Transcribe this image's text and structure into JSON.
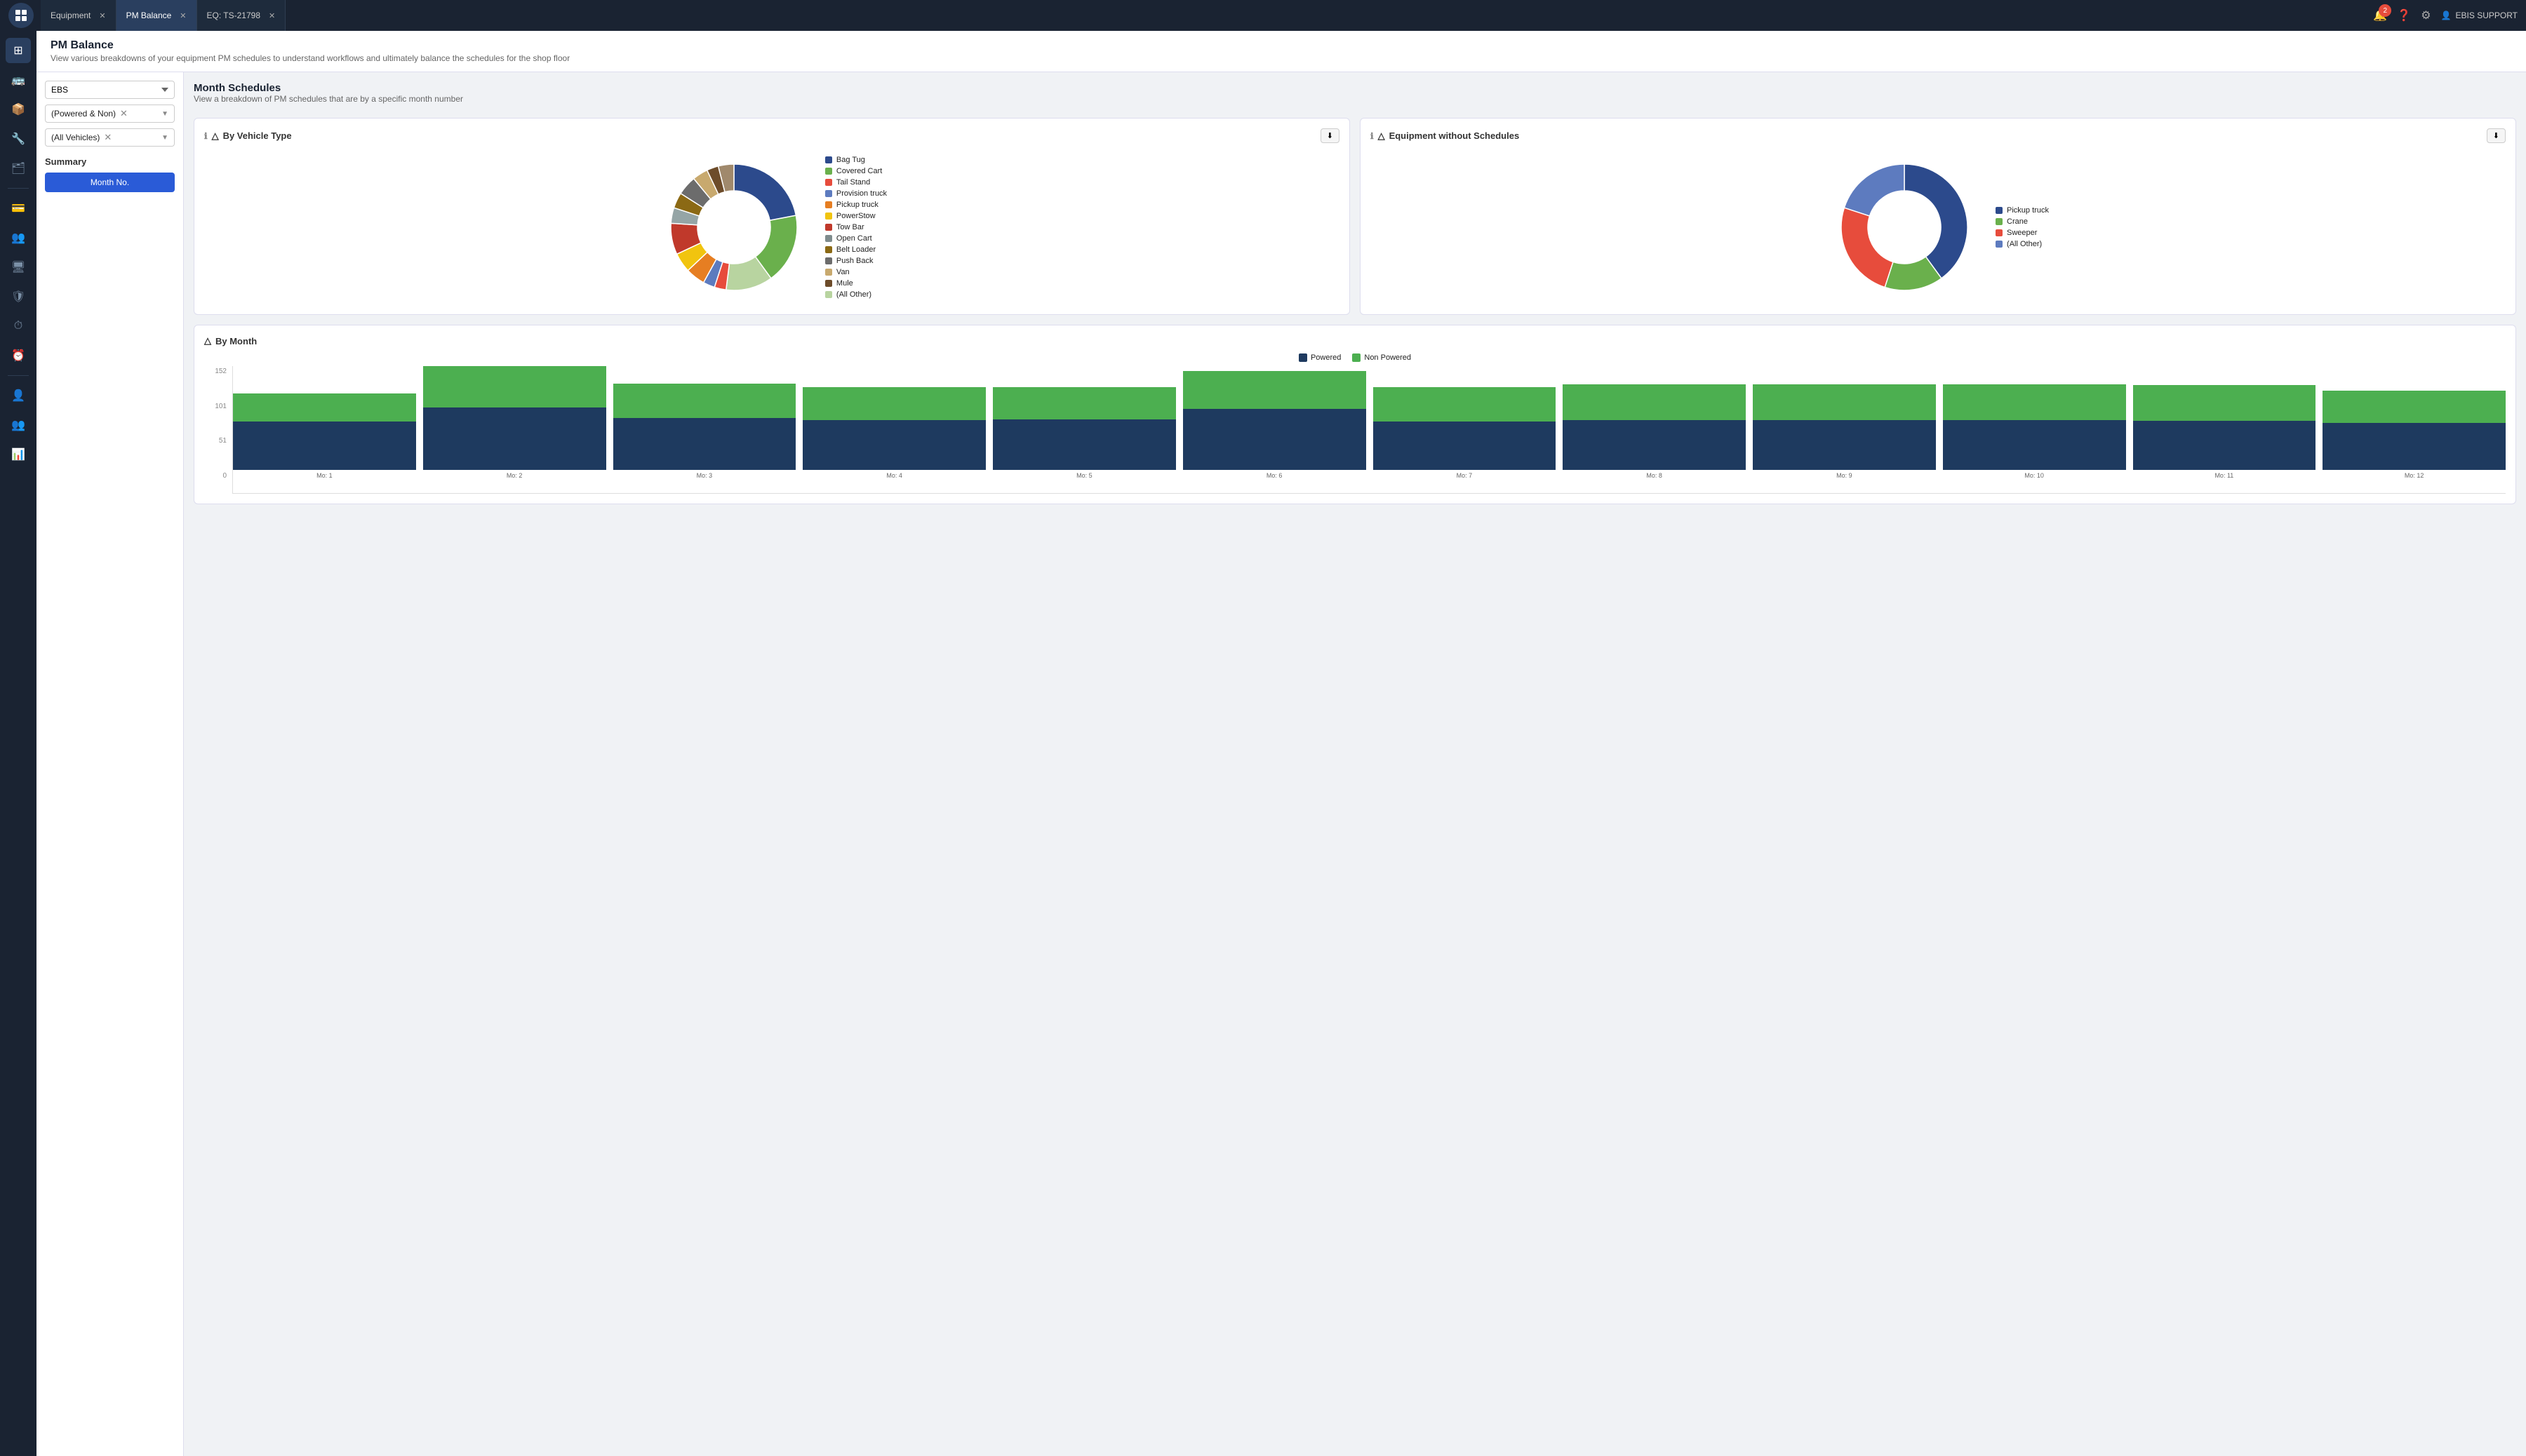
{
  "topbar": {
    "logo_text": "☰",
    "tabs": [
      {
        "label": "Equipment",
        "active": false,
        "closable": true
      },
      {
        "label": "PM Balance",
        "active": true,
        "closable": true
      },
      {
        "label": "EQ: TS-21798",
        "active": false,
        "closable": true
      }
    ],
    "notification_count": "2",
    "user_label": "EBIS SUPPORT"
  },
  "sidebar": {
    "icons": [
      "⊞",
      "🚌",
      "📦",
      "🔧",
      "🗂",
      "💳",
      "👥",
      "🖥",
      "🛡",
      "⏱",
      "⏰",
      "👤",
      "👥",
      "📊"
    ]
  },
  "left_panel": {
    "filter1": "EBS",
    "filter2_label": "(Powered & Non)",
    "filter3_label": "(All Vehicles)",
    "summary_label": "Summary",
    "month_no_label": "Month No."
  },
  "page_header": {
    "title": "PM Balance",
    "subtitle": "View various breakdowns of your equipment PM schedules to understand workflows and ultimately balance the schedules for the shop floor"
  },
  "month_schedules": {
    "title": "Month Schedules",
    "subtitle": "View a breakdown of PM schedules that are by a specific month number",
    "by_vehicle_type_title": "By Vehicle Type",
    "equipment_without_schedules_title": "Equipment without Schedules",
    "by_month_title": "By Month",
    "export_label": "⬇"
  },
  "donut1_legend": [
    {
      "label": "Bag Tug",
      "color": "#2c4a8c"
    },
    {
      "label": "Covered Cart",
      "color": "#6ab04c"
    },
    {
      "label": "Tail Stand",
      "color": "#e74c3c"
    },
    {
      "label": "Provision truck",
      "color": "#5d7bbf"
    },
    {
      "label": "Pickup truck",
      "color": "#e67e22"
    },
    {
      "label": "PowerStow",
      "color": "#f1c40f"
    },
    {
      "label": "Tow Bar",
      "color": "#c0392b"
    },
    {
      "label": "Open Cart",
      "color": "#7f8c8d"
    },
    {
      "label": "Belt Loader",
      "color": "#8B6914"
    },
    {
      "label": "Push Back",
      "color": "#6c6c6c"
    },
    {
      "label": "Van",
      "color": "#c8a96e"
    },
    {
      "label": "Mule",
      "color": "#6d4c2a"
    },
    {
      "label": "(All Other)",
      "color": "#b8d4a0"
    }
  ],
  "donut1_segments": [
    {
      "label": "Bag Tug",
      "color": "#2c4a8c",
      "pct": 22
    },
    {
      "label": "Covered Cart",
      "color": "#6ab04c",
      "pct": 18
    },
    {
      "label": "All Other light",
      "color": "#b8d4a0",
      "pct": 12
    },
    {
      "label": "Tail Stand",
      "color": "#e74c3c",
      "pct": 3
    },
    {
      "label": "Provision truck",
      "color": "#5d7bbf",
      "pct": 3
    },
    {
      "label": "Pickup truck",
      "color": "#e67e22",
      "pct": 5
    },
    {
      "label": "PowerStow",
      "color": "#f1c40f",
      "pct": 5
    },
    {
      "label": "Tow Bar",
      "color": "#c0392b",
      "pct": 8
    },
    {
      "label": "Open Cart",
      "color": "#95a5a6",
      "pct": 4
    },
    {
      "label": "Belt Loader",
      "color": "#8B6914",
      "pct": 4
    },
    {
      "label": "Push Back",
      "color": "#6c6c6c",
      "pct": 5
    },
    {
      "label": "Van",
      "color": "#c8a96e",
      "pct": 4
    },
    {
      "label": "Mule",
      "color": "#6d4c2a",
      "pct": 3
    },
    {
      "label": "tan segment",
      "color": "#a0896c",
      "pct": 4
    }
  ],
  "donut2_legend": [
    {
      "label": "Pickup truck",
      "color": "#2c4a8c"
    },
    {
      "label": "Crane",
      "color": "#6ab04c"
    },
    {
      "label": "Sweeper",
      "color": "#e74c3c"
    },
    {
      "label": "(All Other)",
      "color": "#5d7bbf"
    }
  ],
  "donut2_segments": [
    {
      "label": "Pickup truck",
      "color": "#2c4a8c",
      "pct": 40
    },
    {
      "label": "Crane",
      "color": "#6ab04c",
      "pct": 15
    },
    {
      "label": "Sweeper",
      "color": "#e74c3c",
      "pct": 25
    },
    {
      "label": "(All Other)",
      "color": "#5d7bbf",
      "pct": 20
    }
  ],
  "bar_chart": {
    "legend": [
      {
        "label": "Powered",
        "color": "#1e3a5f"
      },
      {
        "label": "Non Powered",
        "color": "#4caf50"
      }
    ],
    "y_labels": [
      "152",
      "101",
      "51",
      "0"
    ],
    "bars": [
      {
        "label": "Mo: 1",
        "powered": 70,
        "non_powered": 40
      },
      {
        "label": "Mo: 2",
        "powered": 90,
        "non_powered": 60
      },
      {
        "label": "Mo: 3",
        "powered": 75,
        "non_powered": 50
      },
      {
        "label": "Mo: 4",
        "powered": 72,
        "non_powered": 48
      },
      {
        "label": "Mo: 5",
        "powered": 73,
        "non_powered": 47
      },
      {
        "label": "Mo: 6",
        "powered": 88,
        "non_powered": 55
      },
      {
        "label": "Mo: 7",
        "powered": 70,
        "non_powered": 50
      },
      {
        "label": "Mo: 8",
        "powered": 72,
        "non_powered": 52
      },
      {
        "label": "Mo: 9",
        "powered": 72,
        "non_powered": 52
      },
      {
        "label": "Mo: 10",
        "powered": 72,
        "non_powered": 52
      },
      {
        "label": "Mo: 11",
        "powered": 71,
        "non_powered": 52
      },
      {
        "label": "Mo: 12",
        "powered": 68,
        "non_powered": 47
      }
    ],
    "max_val": 152
  }
}
